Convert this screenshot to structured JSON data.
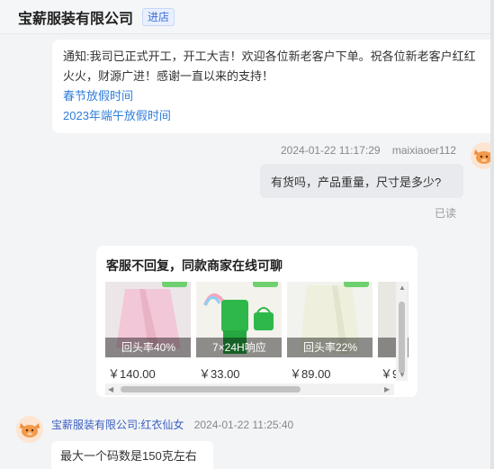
{
  "header": {
    "shop_name": "宝薪服装有限公司",
    "tag": "进店"
  },
  "notice": {
    "text": "通知:我司已正式开工，开工大吉！欢迎各位新老客户下单。祝各位新老客户红红火火，财源广进！感谢一直以来的支持！",
    "links": [
      "春节放假时间",
      "2023年端午放假时间"
    ]
  },
  "outgoing": {
    "timestamp": "2024-01-22 11:17:29",
    "user": "maixiaoer112",
    "message": "有货吗，产品重量，尺寸是多少?",
    "status": "已读"
  },
  "recommend": {
    "title": "客服不回复，同款商家在线可聊",
    "products": [
      {
        "badge": "回头率40%",
        "price": "￥140.00",
        "image": "pink-skirt"
      },
      {
        "badge": "7×24H响应",
        "price": "￥33.00",
        "image": "green-set"
      },
      {
        "badge": "回头率22%",
        "price": "￥89.00",
        "image": "cream-skirt"
      },
      {
        "badge": "",
        "price": "￥9",
        "image": "partial-item"
      }
    ]
  },
  "incoming": {
    "sender": "宝薪服装有限公司:红衣仙女",
    "timestamp": "2024-01-22 11:25:40",
    "message": "最大一个码数是150克左右"
  },
  "icons": {
    "avatar": "shop-mascot-icon",
    "scroll_left": "arrow-left-icon",
    "scroll_right": "arrow-right-icon",
    "scroll_up": "arrow-up-icon",
    "scroll_down": "arrow-down-icon"
  },
  "colors": {
    "link": "#2f7ddb",
    "sender": "#3b5fc0",
    "bubble_out": "#e8eaee",
    "background": "#f3f4f6"
  }
}
